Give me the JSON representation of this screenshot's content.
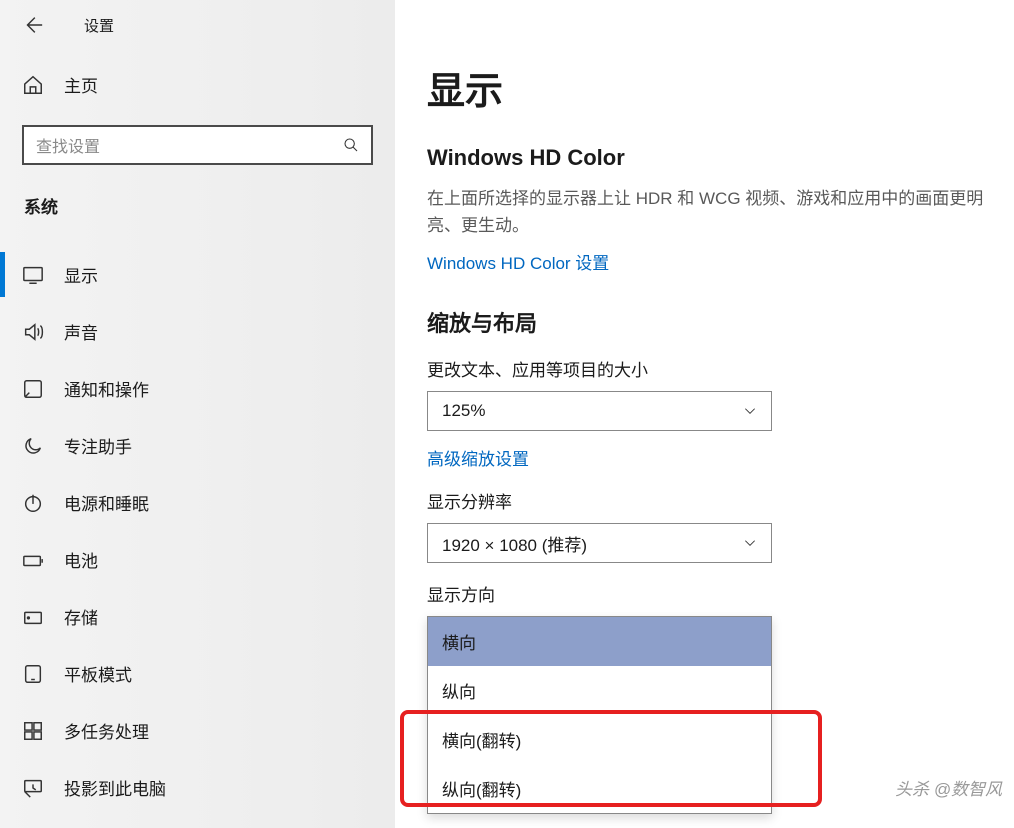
{
  "topbar": {
    "title": "设置"
  },
  "home": {
    "label": "主页"
  },
  "search": {
    "placeholder": "查找设置"
  },
  "sidebar": {
    "section": "系统",
    "items": [
      {
        "label": "显示",
        "icon": "monitor"
      },
      {
        "label": "声音",
        "icon": "sound"
      },
      {
        "label": "通知和操作",
        "icon": "notification"
      },
      {
        "label": "专注助手",
        "icon": "moon"
      },
      {
        "label": "电源和睡眠",
        "icon": "power"
      },
      {
        "label": "电池",
        "icon": "battery"
      },
      {
        "label": "存储",
        "icon": "storage"
      },
      {
        "label": "平板模式",
        "icon": "tablet"
      },
      {
        "label": "多任务处理",
        "icon": "multitask"
      },
      {
        "label": "投影到此电脑",
        "icon": "project"
      }
    ]
  },
  "main": {
    "title": "显示",
    "hd": {
      "heading": "Windows HD Color",
      "desc": "在上面所选择的显示器上让 HDR 和 WCG 视频、游戏和应用中的画面更明亮、更生动。",
      "link": "Windows HD Color 设置"
    },
    "scale": {
      "heading": "缩放与布局",
      "size_label": "更改文本、应用等项目的大小",
      "size_value": "125%",
      "advanced": "高级缩放设置",
      "res_label": "显示分辨率",
      "res_value": "1920 × 1080 (推荐)",
      "orient_label": "显示方向",
      "orient_options": [
        "横向",
        "纵向",
        "横向(翻转)",
        "纵向(翻转)"
      ]
    }
  },
  "watermark": "头杀 @数智风"
}
